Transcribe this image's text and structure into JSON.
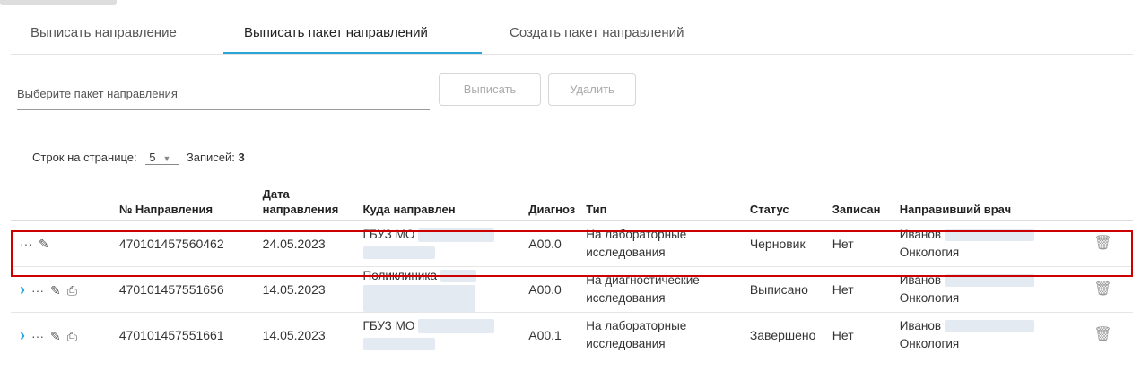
{
  "tabs": [
    {
      "label": "Выписать направление"
    },
    {
      "label": "Выписать пакет направлений"
    },
    {
      "label": "Создать пакет направлений"
    }
  ],
  "package_select": {
    "placeholder": "Выберите пакет направления"
  },
  "buttons": {
    "issue_label": "Выписать",
    "delete_label": "Удалить"
  },
  "paging": {
    "rows_per_page_label": "Строк на странице:",
    "rows_per_page_value": "5",
    "records_label": "Записей:",
    "records_count": "3"
  },
  "table": {
    "headers": {
      "number": "№ Направления",
      "date_line1": "Дата",
      "date_line2": "направления",
      "destination": "Куда направлен",
      "diagnosis": "Диагноз",
      "type": "Тип",
      "status": "Статус",
      "booked": "Записан",
      "doctor": "Направивший врач"
    },
    "rows": [
      {
        "number": "470101457560462",
        "date": "24.05.2023",
        "destination": "ГБУЗ МО",
        "diagnosis": "A00.0",
        "type_line1": "На лабораторные",
        "type_line2": "исследования",
        "status": "Черновик",
        "booked": "Нет",
        "doctor": "Иванов",
        "doctor_dept": "Онкология"
      },
      {
        "number": "470101457551656",
        "date": "14.05.2023",
        "destination": "Поликлиника",
        "diagnosis": "A00.0",
        "type_line1": "На диагностические",
        "type_line2": "исследования",
        "status": "Выписано",
        "booked": "Нет",
        "doctor": "Иванов",
        "doctor_dept": "Онкология"
      },
      {
        "number": "470101457551661",
        "date": "14.05.2023",
        "destination": "ГБУЗ МО",
        "diagnosis": "A00.1",
        "type_line1": "На лабораторные",
        "type_line2": "исследования",
        "status": "Завершено",
        "booked": "Нет",
        "doctor": "Иванов",
        "doctor_dept": "Онкология"
      }
    ]
  },
  "colors": {
    "accent": "#29a6d6",
    "highlight": "#cc0000"
  }
}
